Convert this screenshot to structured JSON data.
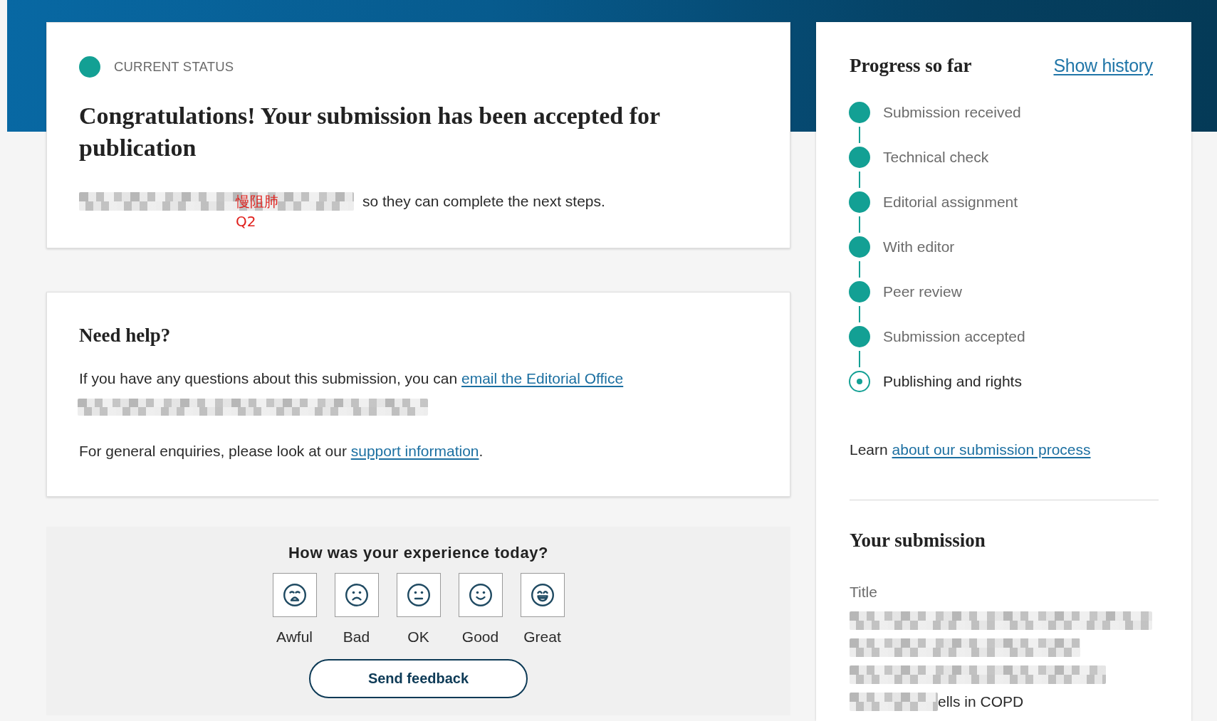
{
  "current_status": {
    "label": "CURRENT STATUS",
    "heading": "Congratulations! Your submission has been accepted for publication",
    "message": [
      {
        "kind": "redacted"
      },
      {
        "kind": "text",
        "text": "so they can complete the next steps."
      }
    ],
    "annotation": [
      "慢阻肺",
      "Q2"
    ]
  },
  "help": {
    "title": "Need help?",
    "lines": [
      {
        "kind": "text",
        "text": "If you have any questions about this submission, you can",
        "link": "email the Editorial Office"
      },
      {
        "kind": "redacted"
      },
      {
        "kind": "text",
        "text": "For general enquiries, please look at our",
        "link": "support information",
        "after": "."
      }
    ]
  },
  "feedback": {
    "question": "How was your experience today?",
    "options": [
      {
        "kind": "awful",
        "label": "Awful",
        "selected": false
      },
      {
        "kind": "bad",
        "label": "Bad",
        "selected": false
      },
      {
        "kind": "ok",
        "label": "OK",
        "selected": false
      },
      {
        "kind": "good",
        "label": "Good",
        "selected": false
      },
      {
        "kind": "great",
        "label": "Great",
        "selected": false
      }
    ],
    "button": "Send feedback"
  },
  "progress": {
    "title": "Progress so far",
    "history_link": "Show history",
    "steps": [
      {
        "label": "Submission received",
        "completed": true,
        "current": false
      },
      {
        "label": "Technical check",
        "completed": true,
        "current": false
      },
      {
        "label": "Editorial assignment",
        "completed": true,
        "current": false
      },
      {
        "label": "With editor",
        "completed": true,
        "current": false
      },
      {
        "label": "Peer review",
        "completed": true,
        "current": false
      },
      {
        "label": "Submission accepted",
        "completed": true,
        "current": false
      },
      {
        "label": "Publishing and rights",
        "completed": false,
        "current": true
      }
    ],
    "learn": {
      "text": "Learn",
      "link": "about our submission process"
    }
  },
  "submission": {
    "title": "Your submission",
    "fields": [
      {
        "label": "Title",
        "lines": [
          [
            {
              "kind": "redacted"
            }
          ],
          [
            {
              "kind": "redacted"
            }
          ],
          [
            {
              "kind": "redacted"
            }
          ],
          [
            {
              "kind": "redacted"
            },
            {
              "kind": "text",
              "text": "ells in COPD"
            }
          ]
        ]
      }
    ]
  }
}
